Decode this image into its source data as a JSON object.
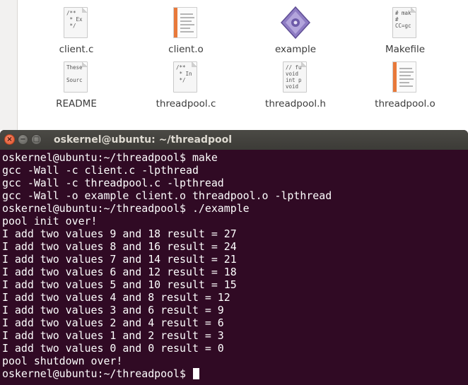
{
  "files": [
    {
      "name": "client.c",
      "icon": "text-c-source-icon",
      "preview": "/**\n * Ex\n */"
    },
    {
      "name": "client.o",
      "icon": "object-file-icon"
    },
    {
      "name": "example",
      "icon": "executable-icon"
    },
    {
      "name": "Makefile",
      "icon": "makefile-icon",
      "preview": "# mak\n#\nCC=gc"
    },
    {
      "name": "README",
      "icon": "text-file-icon",
      "preview": "These\n\nSourc"
    },
    {
      "name": "threadpool.c",
      "icon": "text-c-source-icon",
      "preview": "/**\n * In\n */"
    },
    {
      "name": "threadpool.h",
      "icon": "text-c-header-icon",
      "preview": "// fu\nvoid\nint p\nvoid"
    },
    {
      "name": "threadpool.o",
      "icon": "object-file-icon"
    }
  ],
  "terminal": {
    "title": "oskernel@ubuntu: ~/threadpool",
    "buttons": {
      "close": "×",
      "minimize": "−",
      "maximize": "□"
    },
    "lines": [
      "oskernel@ubuntu:~/threadpool$ make",
      "gcc -Wall -c client.c -lpthread",
      "gcc -Wall -c threadpool.c -lpthread",
      "gcc -Wall -o example client.o threadpool.o -lpthread",
      "oskernel@ubuntu:~/threadpool$ ./example",
      "pool init over!",
      "I add two values 9 and 18 result = 27",
      "I add two values 8 and 16 result = 24",
      "I add two values 7 and 14 result = 21",
      "I add two values 6 and 12 result = 18",
      "I add two values 5 and 10 result = 15",
      "I add two values 4 and 8 result = 12",
      "I add two values 3 and 6 result = 9",
      "I add two values 2 and 4 result = 6",
      "I add two values 1 and 2 result = 3",
      "I add two values 0 and 0 result = 0",
      "pool shutdown over!"
    ],
    "prompt": "oskernel@ubuntu:~/threadpool$ "
  },
  "colors": {
    "terminal_bg": "#300a24",
    "titlebar": "#3c3b37",
    "close_button": "#e0552b",
    "object_stripe": "#e8793a"
  }
}
